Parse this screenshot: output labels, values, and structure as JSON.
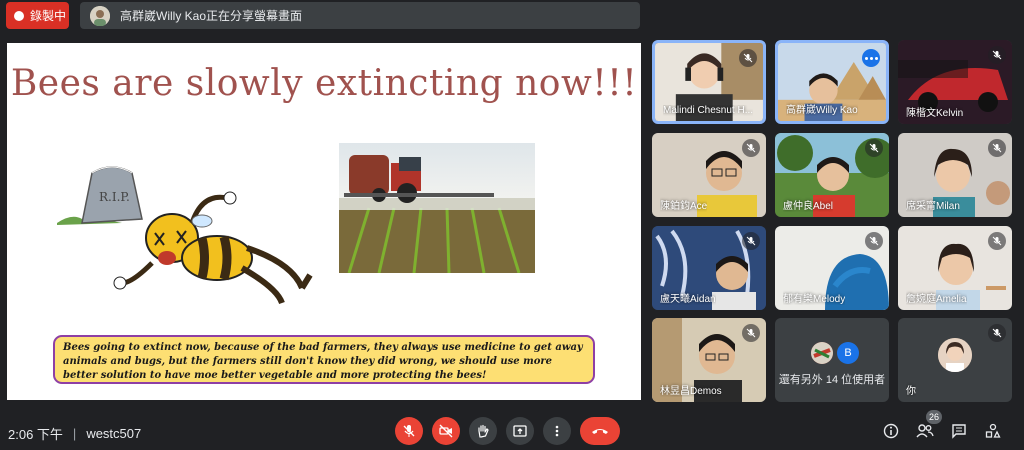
{
  "topbar": {
    "record_label": "錄製中",
    "share_text": "高群崴Willy Kao正在分享螢幕畫面"
  },
  "slide": {
    "title": "Bees are slowly extincting now!!!",
    "caption": "Bees going to extinct now, because of the bad farmers, they always use medicine to get away animals and bugs, but the farmers still don't know they did wrong, we should use more better solution to have moe better vegetable and more protecting the bees!",
    "tombstone_text": "R.I.P."
  },
  "participants": [
    {
      "name": "Malindi Chesnut H..."
    },
    {
      "name": "高群崴Willy Kao"
    },
    {
      "name": "陳楷文Kelvin"
    },
    {
      "name": "陳鉑鈞Ace"
    },
    {
      "name": "盧仲良Abel"
    },
    {
      "name": "席采甯Milan"
    },
    {
      "name": "盧天曦Aidan"
    },
    {
      "name": "郁有樂Melody"
    },
    {
      "name": "詹婉庭Amelia"
    },
    {
      "name": "林昱昌Demos"
    }
  ],
  "others_tile": {
    "text": "還有另外 14 位使用者",
    "avatar_letter": "B"
  },
  "self_tile": {
    "label": "你"
  },
  "bottombar": {
    "time": "2:06 下午",
    "separator": "|",
    "meeting_code": "westc507",
    "people_count": "26"
  },
  "colors": {
    "background": "#202124",
    "record_red": "#d93025",
    "active_blue": "#8ab4f8",
    "hangup_red": "#ea4335",
    "title_brown": "#a0524e",
    "caption_yellow": "#fddf73",
    "caption_border": "#8e3fa5"
  },
  "icons": {
    "record": "record-dot-icon",
    "mic_off": "mic-off-icon",
    "cam_off": "camera-off-icon",
    "hand": "raise-hand-icon",
    "present": "present-screen-icon",
    "more": "more-vert-icon",
    "hangup": "call-end-icon",
    "info": "info-icon",
    "people": "people-icon",
    "chat": "chat-icon",
    "activities": "activities-icon"
  }
}
